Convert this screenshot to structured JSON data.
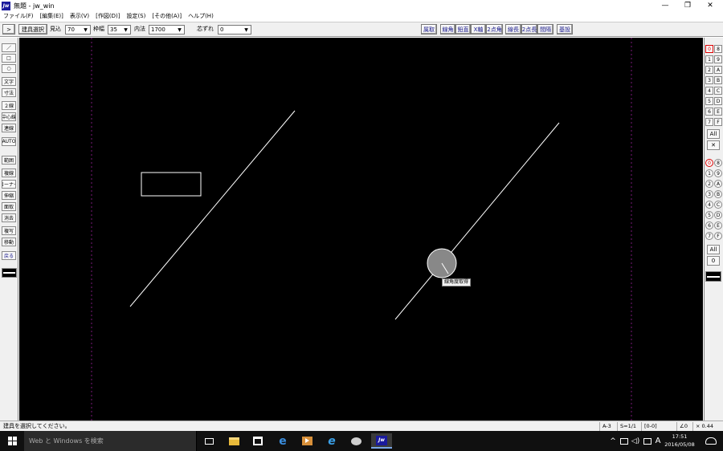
{
  "window": {
    "icon_text": "Jw",
    "title": "無題 - jw_win",
    "controls": {
      "minimize": "—",
      "restore": "❐",
      "close": "✕"
    }
  },
  "menu": {
    "items": [
      "ファイル(F)",
      "[編集(E)]",
      "表示(V)",
      "[作図(D)]",
      "設定(S)",
      "[その他(A)]",
      "ヘルプ(H)"
    ]
  },
  "toolbar": {
    "expand_label": ">",
    "tool_select_label": "建具選択",
    "mikomi_label": "見込",
    "mikomi_value": "70",
    "wakuhaba_label": "枠幅",
    "wakuhaba_value": "35",
    "naiho_label": "内法",
    "naiho_value": "1700",
    "shinzure_label": "芯ずれ",
    "shinzure_value": "0",
    "right_buttons": [
      "属取",
      "線角",
      "鉛直",
      "X軸",
      "2点角",
      "線長",
      "2点長",
      "間隔",
      "基設"
    ]
  },
  "left_tools": {
    "group1": [
      "／",
      "□",
      "○",
      "文字",
      "寸法",
      "２線",
      "中心線",
      "連線",
      "AUTO"
    ],
    "group2": [
      "範囲",
      "複線",
      "コーナー",
      "伸縮",
      "面取",
      "消去",
      "複写",
      "移動",
      "戻る"
    ]
  },
  "right_layers": {
    "group_a": [
      [
        "0",
        "8"
      ],
      [
        "1",
        "9"
      ],
      [
        "2",
        "A"
      ],
      [
        "3",
        "B"
      ],
      [
        "4",
        "C"
      ],
      [
        "5",
        "D"
      ],
      [
        "6",
        "E"
      ],
      [
        "7",
        "F"
      ]
    ],
    "group_a_all": "All",
    "group_a_x": "✕",
    "group_b": [
      [
        "0",
        "8"
      ],
      [
        "1",
        "9"
      ],
      [
        "2",
        "A"
      ],
      [
        "3",
        "B"
      ],
      [
        "4",
        "C"
      ],
      [
        "5",
        "D"
      ],
      [
        "6",
        "E"
      ],
      [
        "7",
        "F"
      ]
    ],
    "group_b_all": "All",
    "group_b_zero": "0"
  },
  "canvas": {
    "tooltip": "線角度取得"
  },
  "status": {
    "message": "建具を選択してください。",
    "paper": "A-3",
    "scale": "S=1/1",
    "layer": "[0-0]",
    "angle": "∠0",
    "zoom": "× 0.44"
  },
  "taskbar": {
    "search_placeholder": "Web と Windows を検索",
    "tray_lang": "A",
    "time": "17:51",
    "date": "2016/05/08"
  }
}
